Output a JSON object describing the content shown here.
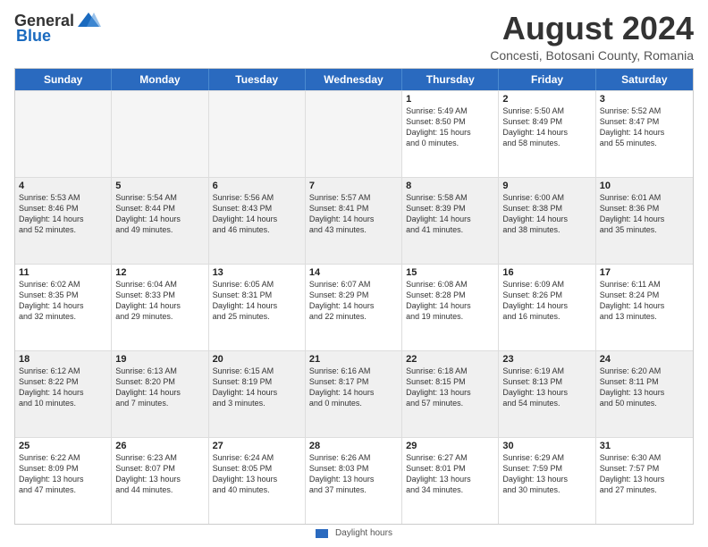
{
  "logo": {
    "general": "General",
    "blue": "Blue"
  },
  "title": "August 2024",
  "location": "Concesti, Botosani County, Romania",
  "days_of_week": [
    "Sunday",
    "Monday",
    "Tuesday",
    "Wednesday",
    "Thursday",
    "Friday",
    "Saturday"
  ],
  "footer_label": "Daylight hours",
  "rows": [
    [
      {
        "day": "",
        "text": "",
        "empty": true
      },
      {
        "day": "",
        "text": "",
        "empty": true
      },
      {
        "day": "",
        "text": "",
        "empty": true
      },
      {
        "day": "",
        "text": "",
        "empty": true
      },
      {
        "day": "1",
        "text": "Sunrise: 5:49 AM\nSunset: 8:50 PM\nDaylight: 15 hours\nand 0 minutes.",
        "empty": false
      },
      {
        "day": "2",
        "text": "Sunrise: 5:50 AM\nSunset: 8:49 PM\nDaylight: 14 hours\nand 58 minutes.",
        "empty": false
      },
      {
        "day": "3",
        "text": "Sunrise: 5:52 AM\nSunset: 8:47 PM\nDaylight: 14 hours\nand 55 minutes.",
        "empty": false
      }
    ],
    [
      {
        "day": "4",
        "text": "Sunrise: 5:53 AM\nSunset: 8:46 PM\nDaylight: 14 hours\nand 52 minutes.",
        "empty": false
      },
      {
        "day": "5",
        "text": "Sunrise: 5:54 AM\nSunset: 8:44 PM\nDaylight: 14 hours\nand 49 minutes.",
        "empty": false
      },
      {
        "day": "6",
        "text": "Sunrise: 5:56 AM\nSunset: 8:43 PM\nDaylight: 14 hours\nand 46 minutes.",
        "empty": false
      },
      {
        "day": "7",
        "text": "Sunrise: 5:57 AM\nSunset: 8:41 PM\nDaylight: 14 hours\nand 43 minutes.",
        "empty": false
      },
      {
        "day": "8",
        "text": "Sunrise: 5:58 AM\nSunset: 8:39 PM\nDaylight: 14 hours\nand 41 minutes.",
        "empty": false
      },
      {
        "day": "9",
        "text": "Sunrise: 6:00 AM\nSunset: 8:38 PM\nDaylight: 14 hours\nand 38 minutes.",
        "empty": false
      },
      {
        "day": "10",
        "text": "Sunrise: 6:01 AM\nSunset: 8:36 PM\nDaylight: 14 hours\nand 35 minutes.",
        "empty": false
      }
    ],
    [
      {
        "day": "11",
        "text": "Sunrise: 6:02 AM\nSunset: 8:35 PM\nDaylight: 14 hours\nand 32 minutes.",
        "empty": false
      },
      {
        "day": "12",
        "text": "Sunrise: 6:04 AM\nSunset: 8:33 PM\nDaylight: 14 hours\nand 29 minutes.",
        "empty": false
      },
      {
        "day": "13",
        "text": "Sunrise: 6:05 AM\nSunset: 8:31 PM\nDaylight: 14 hours\nand 25 minutes.",
        "empty": false
      },
      {
        "day": "14",
        "text": "Sunrise: 6:07 AM\nSunset: 8:29 PM\nDaylight: 14 hours\nand 22 minutes.",
        "empty": false
      },
      {
        "day": "15",
        "text": "Sunrise: 6:08 AM\nSunset: 8:28 PM\nDaylight: 14 hours\nand 19 minutes.",
        "empty": false
      },
      {
        "day": "16",
        "text": "Sunrise: 6:09 AM\nSunset: 8:26 PM\nDaylight: 14 hours\nand 16 minutes.",
        "empty": false
      },
      {
        "day": "17",
        "text": "Sunrise: 6:11 AM\nSunset: 8:24 PM\nDaylight: 14 hours\nand 13 minutes.",
        "empty": false
      }
    ],
    [
      {
        "day": "18",
        "text": "Sunrise: 6:12 AM\nSunset: 8:22 PM\nDaylight: 14 hours\nand 10 minutes.",
        "empty": false
      },
      {
        "day": "19",
        "text": "Sunrise: 6:13 AM\nSunset: 8:20 PM\nDaylight: 14 hours\nand 7 minutes.",
        "empty": false
      },
      {
        "day": "20",
        "text": "Sunrise: 6:15 AM\nSunset: 8:19 PM\nDaylight: 14 hours\nand 3 minutes.",
        "empty": false
      },
      {
        "day": "21",
        "text": "Sunrise: 6:16 AM\nSunset: 8:17 PM\nDaylight: 14 hours\nand 0 minutes.",
        "empty": false
      },
      {
        "day": "22",
        "text": "Sunrise: 6:18 AM\nSunset: 8:15 PM\nDaylight: 13 hours\nand 57 minutes.",
        "empty": false
      },
      {
        "day": "23",
        "text": "Sunrise: 6:19 AM\nSunset: 8:13 PM\nDaylight: 13 hours\nand 54 minutes.",
        "empty": false
      },
      {
        "day": "24",
        "text": "Sunrise: 6:20 AM\nSunset: 8:11 PM\nDaylight: 13 hours\nand 50 minutes.",
        "empty": false
      }
    ],
    [
      {
        "day": "25",
        "text": "Sunrise: 6:22 AM\nSunset: 8:09 PM\nDaylight: 13 hours\nand 47 minutes.",
        "empty": false
      },
      {
        "day": "26",
        "text": "Sunrise: 6:23 AM\nSunset: 8:07 PM\nDaylight: 13 hours\nand 44 minutes.",
        "empty": false
      },
      {
        "day": "27",
        "text": "Sunrise: 6:24 AM\nSunset: 8:05 PM\nDaylight: 13 hours\nand 40 minutes.",
        "empty": false
      },
      {
        "day": "28",
        "text": "Sunrise: 6:26 AM\nSunset: 8:03 PM\nDaylight: 13 hours\nand 37 minutes.",
        "empty": false
      },
      {
        "day": "29",
        "text": "Sunrise: 6:27 AM\nSunset: 8:01 PM\nDaylight: 13 hours\nand 34 minutes.",
        "empty": false
      },
      {
        "day": "30",
        "text": "Sunrise: 6:29 AM\nSunset: 7:59 PM\nDaylight: 13 hours\nand 30 minutes.",
        "empty": false
      },
      {
        "day": "31",
        "text": "Sunrise: 6:30 AM\nSunset: 7:57 PM\nDaylight: 13 hours\nand 27 minutes.",
        "empty": false
      }
    ]
  ]
}
